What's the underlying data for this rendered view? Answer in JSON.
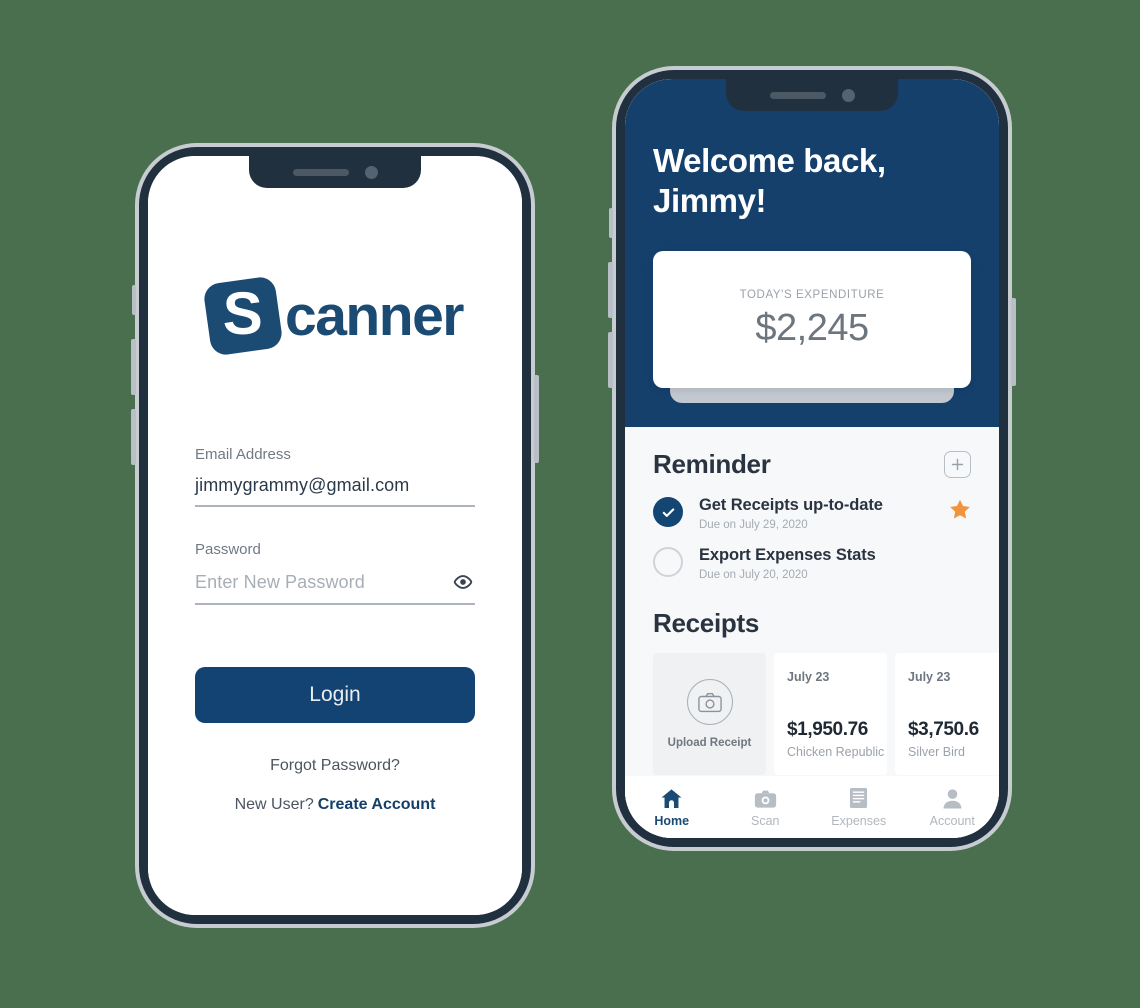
{
  "background_color": "#4a6f4f",
  "brand": {
    "primary_blue": "#14406b",
    "accent_orange": "#f0943e",
    "logo_letter": "S",
    "logo_word": "canner"
  },
  "login_phone": {
    "name": "login-screen",
    "email": {
      "label": "Email Address",
      "value": "jimmygrammy@gmail.com",
      "placeholder": "Email Address"
    },
    "password": {
      "label": "Password",
      "value": "",
      "placeholder": "Enter New Password",
      "toggle_icon": "eye-icon"
    },
    "login_button": "Login",
    "forgot_password": "Forgot Password?",
    "new_user_prompt": "New User?",
    "create_account": "Create Account"
  },
  "dashboard_phone": {
    "greeting": "Welcome back, Jimmy!",
    "expenditure_card": {
      "label": "TODAY'S EXPENDITURE",
      "value": "$2,245"
    },
    "reminder": {
      "title": "Reminder",
      "add_icon": "plus-icon",
      "items": [
        {
          "title": "Get Receipts up-to-date",
          "due": "Due on July 29, 2020",
          "completed": true,
          "starred": true
        },
        {
          "title": "Export Expenses Stats",
          "due": "Due on July 20, 2020",
          "completed": false,
          "starred": false
        }
      ]
    },
    "receipts": {
      "title": "Receipts",
      "upload": {
        "label": "Upload Receipt",
        "icon": "camera-icon"
      },
      "items": [
        {
          "date": "July 23",
          "amount": "$1,950.76",
          "merchant": "Chicken Republic"
        },
        {
          "date": "July 23",
          "amount": "$3,750.6",
          "merchant": "Silver Bird"
        }
      ]
    },
    "tabbar": [
      {
        "label": "Home",
        "icon": "home-icon",
        "active": true
      },
      {
        "label": "Scan",
        "icon": "camera-icon",
        "active": false
      },
      {
        "label": "Expenses",
        "icon": "document-icon",
        "active": false
      },
      {
        "label": "Account",
        "icon": "person-icon",
        "active": false
      }
    ]
  }
}
